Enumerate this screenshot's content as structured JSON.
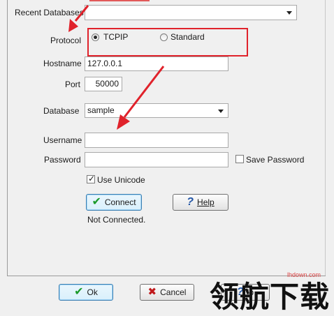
{
  "form": {
    "recent_databases_label": "Recent Databases",
    "recent_databases_value": "",
    "protocol_label": "Protocol",
    "protocol_options": [
      "TCPIP",
      "Standard"
    ],
    "protocol_selected": "TCPIP",
    "hostname_label": "Hostname",
    "hostname_value": "127.0.0.1",
    "port_label": "Port",
    "port_value": "50000",
    "database_label": "Database",
    "database_value": "sample",
    "username_label": "Username",
    "username_value": "",
    "password_label": "Password",
    "password_value": "",
    "save_password_label": "Save Password",
    "save_password_checked": false,
    "use_unicode_label": "Use Unicode",
    "use_unicode_checked": true
  },
  "actions": {
    "connect_label": "Connect",
    "help_label": "Help",
    "status_text": "Not Connected."
  },
  "footer": {
    "ok_label": "Ok",
    "cancel_label": "Cancel",
    "partial_label": "lp"
  },
  "watermark": {
    "main_text": "领航下载",
    "url_text": "lhdown.com"
  },
  "colors": {
    "annotation_red": "#e0222b",
    "background": "#f0f0f0",
    "connect_button_border": "#3c7fb1"
  }
}
